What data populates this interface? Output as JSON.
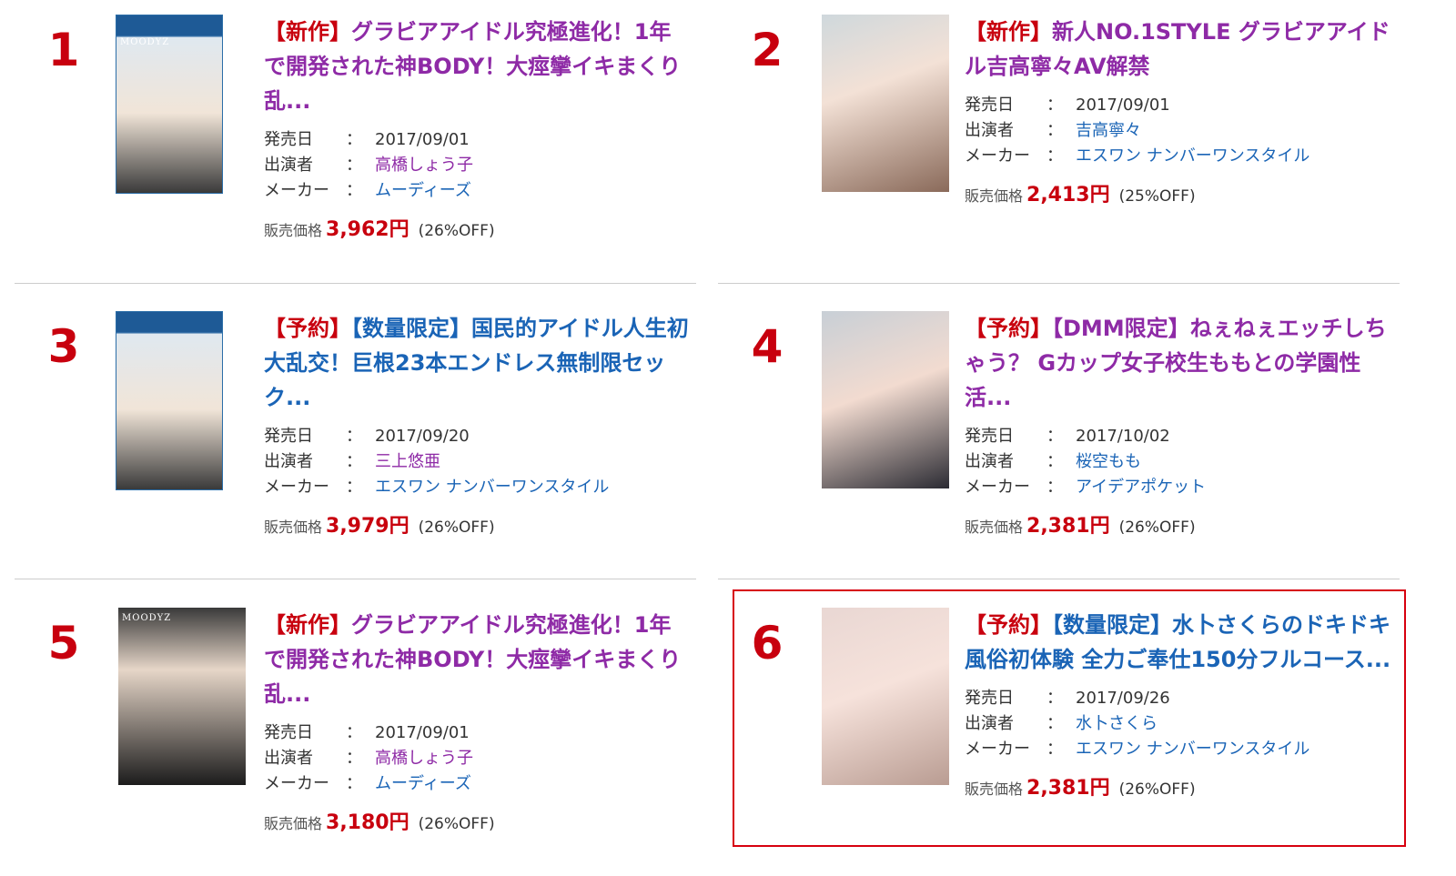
{
  "items": [
    {
      "rank": "1",
      "title_tags": [
        "【新作】"
      ],
      "title_text": "グラビアアイドル究極進化！1年で開発された神BODY！大痙攣イキまくり乱...",
      "release_label": "発売日",
      "release_date": "2017/09/01",
      "performer_label": "出演者",
      "performer": "高橋しょう子",
      "maker_label": "メーカー",
      "maker": "ムーディーズ",
      "price_label": "販売価格",
      "price": "3,962円",
      "discount": "(26%OFF)",
      "thumb_text": "MOODYZ"
    },
    {
      "rank": "2",
      "title_tags": [
        "【新作】"
      ],
      "title_text": "新人NO.1STYLE グラビアアイドル吉高寧々AV解禁",
      "release_label": "発売日",
      "release_date": "2017/09/01",
      "performer_label": "出演者",
      "performer": "吉高寧々",
      "maker_label": "メーカー",
      "maker": "エスワン ナンバーワンスタイル",
      "price_label": "販売価格",
      "price": "2,413円",
      "discount": "(25%OFF)",
      "thumb_text": ""
    },
    {
      "rank": "3",
      "title_tags": [
        "【予約】"
      ],
      "title_text": "【数量限定】国民的アイドル人生初大乱交！巨根23本エンドレス無制限セック...",
      "release_label": "発売日",
      "release_date": "2017/09/20",
      "performer_label": "出演者",
      "performer": "三上悠亜",
      "maker_label": "メーカー",
      "maker": "エスワン ナンバーワンスタイル",
      "price_label": "販売価格",
      "price": "3,979円",
      "discount": "(26%OFF)",
      "thumb_text": ""
    },
    {
      "rank": "4",
      "title_tags": [
        "【予約】"
      ],
      "title_text": "【DMM限定】ねぇねぇエッチしちゃう？ Gカップ女子校生ももとの学園性活...",
      "release_label": "発売日",
      "release_date": "2017/10/02",
      "performer_label": "出演者",
      "performer": "桜空もも",
      "maker_label": "メーカー",
      "maker": "アイデアポケット",
      "price_label": "販売価格",
      "price": "2,381円",
      "discount": "(26%OFF)",
      "thumb_text": ""
    },
    {
      "rank": "5",
      "title_tags": [
        "【新作】"
      ],
      "title_text": "グラビアアイドル究極進化！1年で開発された神BODY！大痙攣イキまくり乱...",
      "release_label": "発売日",
      "release_date": "2017/09/01",
      "performer_label": "出演者",
      "performer": "高橋しょう子",
      "maker_label": "メーカー",
      "maker": "ムーディーズ",
      "price_label": "販売価格",
      "price": "3,180円",
      "discount": "(26%OFF)",
      "thumb_text": "MOODYZ"
    },
    {
      "rank": "6",
      "title_tags": [
        "【予約】"
      ],
      "title_text": "【数量限定】水卜さくらのドキドキ風俗初体験 全力ご奉仕150分フルコース...",
      "release_label": "発売日",
      "release_date": "2017/09/26",
      "performer_label": "出演者",
      "performer": "水卜さくら",
      "maker_label": "メーカー",
      "maker": "エスワン ナンバーワンスタイル",
      "price_label": "販売価格",
      "price": "2,381円",
      "discount": "(26%OFF)",
      "thumb_text": ""
    }
  ],
  "meta_separator": "：",
  "colors": {
    "rank": "#c8000e",
    "title_purple": "#8e2aa6",
    "title_blue": "#1a64b6",
    "price": "#c8000e",
    "highlight_border": "#d7000f"
  }
}
